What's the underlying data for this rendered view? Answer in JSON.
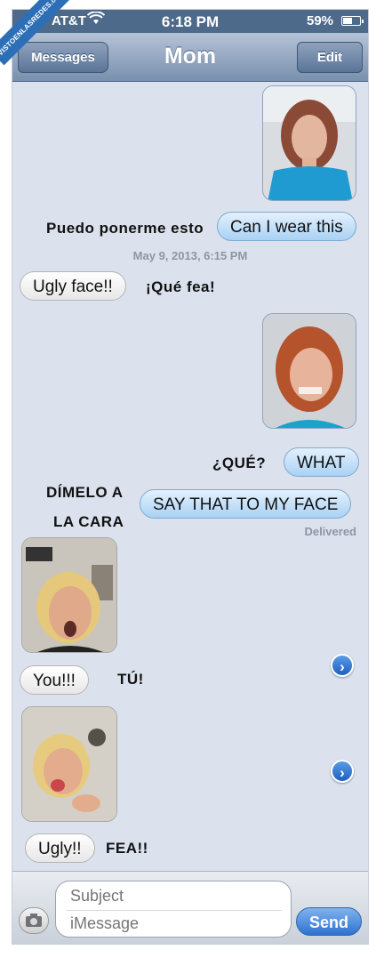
{
  "watermark": "VISTOENLASREDES.com",
  "status_bar": {
    "carrier": "AT&T",
    "time": "6:18 PM",
    "battery_percent": "59%",
    "battery_level": 0.59
  },
  "nav": {
    "back_label": "Messages",
    "title": "Mom",
    "edit_label": "Edit"
  },
  "messages": {
    "m1_text": "Can I wear this",
    "m1_caption": "Puedo ponerme esto",
    "timestamp": "May 9, 2013, 6:15 PM",
    "m2_text": "Ugly face!!",
    "m2_caption": "¡Qué fea!",
    "m3_text": "WHAT",
    "m3_caption": "¿QUÉ?",
    "m4_text": "SAY THAT TO MY FACE",
    "m4_caption_line1": "DÍMELO A",
    "m4_caption_line2": "LA CARA",
    "delivered": "Delivered",
    "m5_text": "You!!!",
    "m5_caption": "TÚ!",
    "m6_text": "Ugly!!",
    "m6_caption": "FEA!!"
  },
  "input_bar": {
    "subject_placeholder": "Subject",
    "message_placeholder": "iMessage",
    "send_label": "Send"
  },
  "icons": {
    "camera": "camera-icon",
    "wifi": "wifi-icon",
    "battery": "battery-icon",
    "disclosure": "chevron-right-icon"
  }
}
